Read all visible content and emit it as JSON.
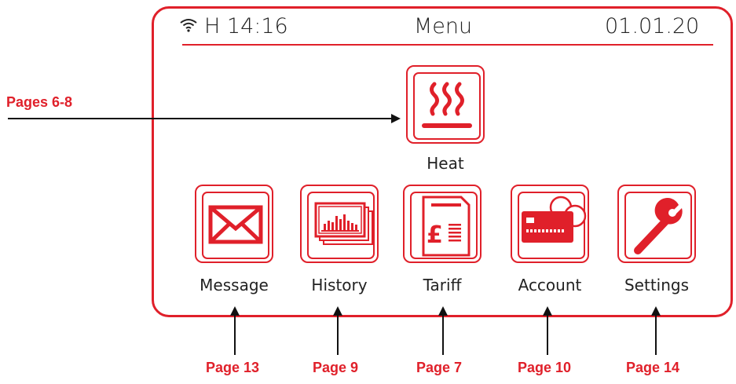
{
  "header": {
    "status_left": "H 14:16",
    "title": "Menu",
    "date": "01.01.20"
  },
  "menu": {
    "heat": "Heat",
    "message": "Message",
    "history": "History",
    "tariff": "Tariff",
    "account": "Account",
    "settings": "Settings"
  },
  "callouts": {
    "heat": "Pages 6-8",
    "message": "Page 13",
    "history": "Page 9",
    "tariff": "Page 7",
    "account": "Page 10",
    "settings": "Page 14"
  },
  "icons": {
    "status": "wifi-icon",
    "heat": "heat-icon",
    "message": "envelope-icon",
    "history": "bar-chart-icon",
    "tariff": "pound-document-icon",
    "account": "card-icon",
    "settings": "wrench-icon"
  },
  "colors": {
    "accent": "#e0202a",
    "text": "#222222"
  }
}
